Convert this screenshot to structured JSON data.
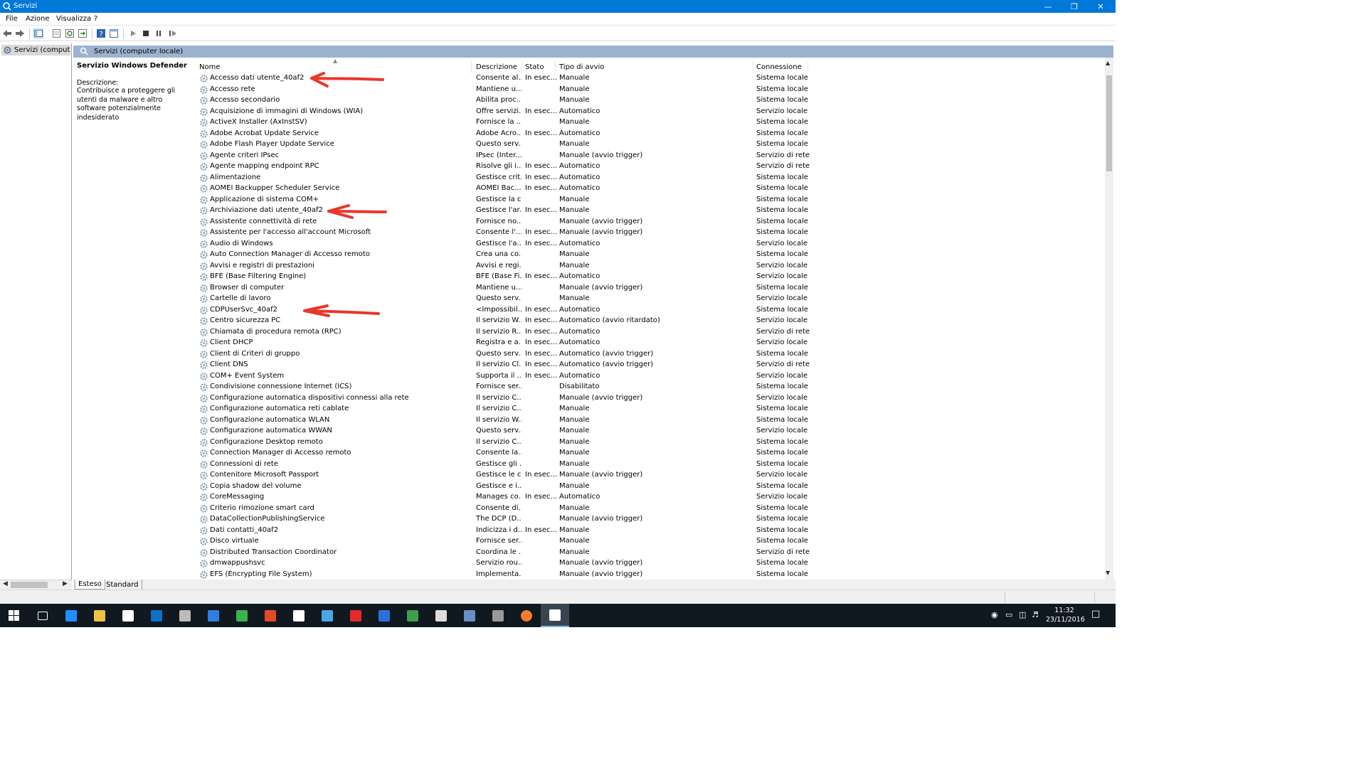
{
  "window": {
    "title": "Servizi",
    "controls": {
      "minimize": "—",
      "maximize": "❐",
      "close": "✕"
    }
  },
  "menu": [
    "File",
    "Azione",
    "Visualizza",
    "?"
  ],
  "tree": {
    "item": "Servizi (computer locale)"
  },
  "main": {
    "header_title": "Servizi (computer locale)",
    "details": {
      "title": "Servizio Windows Defender",
      "desc_label": "Descrizione:",
      "desc_text": "Contribuisce a proteggere gli utenti da malware e altro software potenzialmente indesiderato"
    },
    "columns": {
      "name": "Nome",
      "desc": "Descrizione",
      "stato": "Stato",
      "tipo": "Tipo di avvio",
      "conn": "Connessione"
    },
    "rows": [
      [
        "Accesso dati utente_40af2",
        "Consente al...",
        "In esec...",
        "Manuale",
        "Sistema locale"
      ],
      [
        "Accesso rete",
        "Mantiene u...",
        "",
        "Manuale",
        "Sistema locale"
      ],
      [
        "Accesso secondario",
        "Abilita proc...",
        "",
        "Manuale",
        "Sistema locale"
      ],
      [
        "Acquisizione di immagini di Windows (WIA)",
        "Offre servizi...",
        "In esec...",
        "Automatico",
        "Servizio locale"
      ],
      [
        "ActiveX Installer (AxInstSV)",
        "Fornisce la ...",
        "",
        "Manuale",
        "Sistema locale"
      ],
      [
        "Adobe Acrobat Update Service",
        "Adobe Acro...",
        "In esec...",
        "Automatico",
        "Sistema locale"
      ],
      [
        "Adobe Flash Player Update Service",
        "Questo serv...",
        "",
        "Manuale",
        "Sistema locale"
      ],
      [
        "Agente criteri IPsec",
        "IPsec (Inter...",
        "",
        "Manuale (avvio trigger)",
        "Servizio di rete"
      ],
      [
        "Agente mapping endpoint RPC",
        "Risolve gli i...",
        "In esec...",
        "Automatico",
        "Servizio di rete"
      ],
      [
        "Alimentazione",
        "Gestisce crit...",
        "In esec...",
        "Automatico",
        "Sistema locale"
      ],
      [
        "AOMEI Backupper Scheduler Service",
        "AOMEI Bac...",
        "In esec...",
        "Automatico",
        "Sistema locale"
      ],
      [
        "Applicazione di sistema COM+",
        "Gestisce la c...",
        "",
        "Manuale",
        "Sistema locale"
      ],
      [
        "Archiviazione dati utente_40af2",
        "Gestisce l'ar...",
        "In esec...",
        "Manuale",
        "Sistema locale"
      ],
      [
        "Assistente connettività di rete",
        "Fornisce no...",
        "",
        "Manuale (avvio trigger)",
        "Sistema locale"
      ],
      [
        "Assistente per l'accesso all'account Microsoft",
        "Consente l'...",
        "In esec...",
        "Manuale (avvio trigger)",
        "Sistema locale"
      ],
      [
        "Audio di Windows",
        "Gestisce l'a...",
        "In esec...",
        "Automatico",
        "Servizio locale"
      ],
      [
        "Auto Connection Manager di Accesso remoto",
        "Crea una co...",
        "",
        "Manuale",
        "Sistema locale"
      ],
      [
        "Avvisi e registri di prestazioni",
        "Avvisi e regi...",
        "",
        "Manuale",
        "Servizio locale"
      ],
      [
        "BFE (Base Filtering Engine)",
        "BFE (Base Fi...",
        "In esec...",
        "Automatico",
        "Servizio locale"
      ],
      [
        "Browser di computer",
        "Mantiene u...",
        "",
        "Manuale (avvio trigger)",
        "Sistema locale"
      ],
      [
        "Cartelle di lavoro",
        "Questo serv...",
        "",
        "Manuale",
        "Servizio locale"
      ],
      [
        "CDPUserSvc_40af2",
        "<Impossibil...",
        "In esec...",
        "Automatico",
        "Sistema locale"
      ],
      [
        "Centro sicurezza PC",
        "Il servizio W...",
        "In esec...",
        "Automatico (avvio ritardato)",
        "Servizio locale"
      ],
      [
        "Chiamata di procedura remota (RPC)",
        "Il servizio R...",
        "In esec...",
        "Automatico",
        "Servizio di rete"
      ],
      [
        "Client DHCP",
        "Registra e a...",
        "In esec...",
        "Automatico",
        "Servizio locale"
      ],
      [
        "Client di Criteri di gruppo",
        "Questo serv...",
        "In esec...",
        "Automatico (avvio trigger)",
        "Sistema locale"
      ],
      [
        "Client DNS",
        "Il servizio Cl...",
        "In esec...",
        "Automatico (avvio trigger)",
        "Servizio di rete"
      ],
      [
        "COM+ Event System",
        "Supporta il ...",
        "In esec...",
        "Automatico",
        "Servizio locale"
      ],
      [
        "Condivisione connessione Internet (ICS)",
        "Fornisce ser...",
        "",
        "Disabilitato",
        "Sistema locale"
      ],
      [
        "Configurazione automatica dispositivi connessi alla rete",
        "Il servizio C...",
        "",
        "Manuale (avvio trigger)",
        "Servizio locale"
      ],
      [
        "Configurazione automatica reti cablate",
        "Il servizio C...",
        "",
        "Manuale",
        "Sistema locale"
      ],
      [
        "Configurazione automatica WLAN",
        "Il servizio W...",
        "",
        "Manuale",
        "Sistema locale"
      ],
      [
        "Configurazione automatica WWAN",
        "Questo serv...",
        "",
        "Manuale",
        "Servizio locale"
      ],
      [
        "Configurazione Desktop remoto",
        "Il servizio C...",
        "",
        "Manuale",
        "Sistema locale"
      ],
      [
        "Connection Manager di Accesso remoto",
        "Consente la...",
        "",
        "Manuale",
        "Sistema locale"
      ],
      [
        "Connessioni di rete",
        "Gestisce gli ...",
        "",
        "Manuale",
        "Sistema locale"
      ],
      [
        "Contenitore Microsoft Passport",
        "Gestisce le c...",
        "In esec...",
        "Manuale (avvio trigger)",
        "Servizio locale"
      ],
      [
        "Copia shadow del volume",
        "Gestisce e i...",
        "",
        "Manuale",
        "Sistema locale"
      ],
      [
        "CoreMessaging",
        "Manages co...",
        "In esec...",
        "Automatico",
        "Servizio locale"
      ],
      [
        "Criterio rimozione smart card",
        "Consente di...",
        "",
        "Manuale",
        "Sistema locale"
      ],
      [
        "DataCollectionPublishingService",
        "The DCP (D...",
        "",
        "Manuale (avvio trigger)",
        "Sistema locale"
      ],
      [
        "Dati contatti_40af2",
        "Indicizza i d...",
        "In esec...",
        "Manuale",
        "Sistema locale"
      ],
      [
        "Disco virtuale",
        "Fornisce ser...",
        "",
        "Manuale",
        "Sistema locale"
      ],
      [
        "Distributed Transaction Coordinator",
        "Coordina le ...",
        "",
        "Manuale",
        "Servizio di rete"
      ],
      [
        "dmwappushsvc",
        "Servizio rou...",
        "",
        "Manuale (avvio trigger)",
        "Sistema locale"
      ],
      [
        "EFS (Encrypting File System)",
        "Implementa...",
        "",
        "Manuale (avvio trigger)",
        "Sistema locale"
      ]
    ]
  },
  "tabs": [
    "Esteso",
    "Standard"
  ],
  "clock": {
    "time": "11:32",
    "date": "23/11/2016"
  },
  "colors": {
    "titlebar": "#0078d7",
    "panel_header": "#9cb3d0",
    "taskbar": "#101820",
    "annotation_arrow": "#e8372c"
  },
  "taskbar_icons": [
    "windows-start-icon",
    "task-view-icon",
    "edge-icon",
    "file-explorer-icon",
    "store-icon",
    "outlook-icon",
    "network-icon",
    "teamviewer-icon",
    "security-shield-icon",
    "ccleaner-icon",
    "shield-icon",
    "search-app-icon",
    "avira-icon",
    "malwarebytes-icon",
    "magnifier-icon",
    "calculator-icon",
    "defender-icon",
    "keepass-icon",
    "firefox-icon",
    "services-icon"
  ]
}
